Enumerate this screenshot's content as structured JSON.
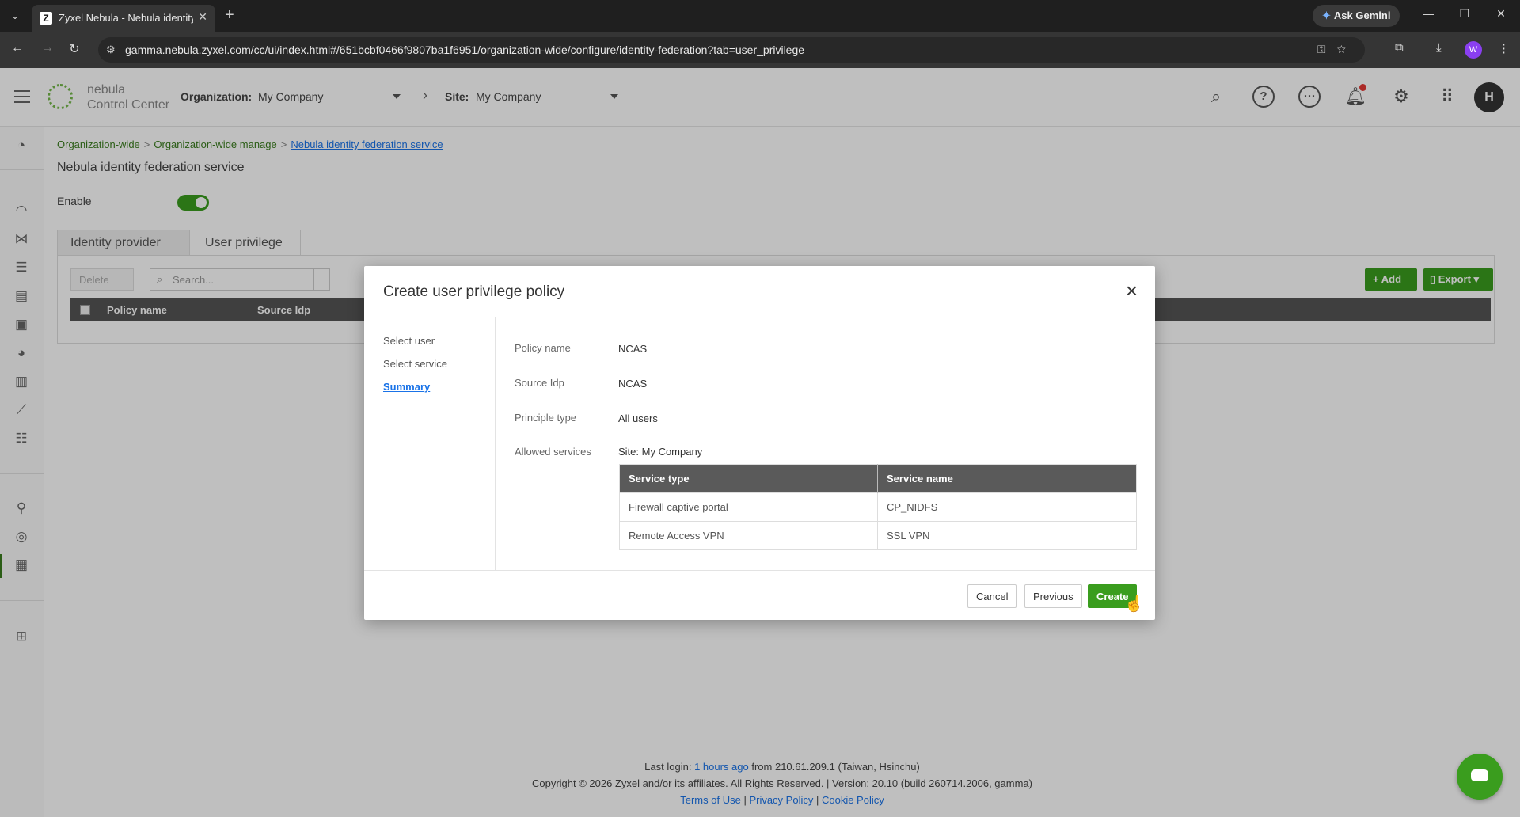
{
  "browser": {
    "tab_title": "Zyxel Nebula - Nebula identity",
    "url": "gamma.nebula.zyxel.com/cc/ui/index.html#/651bcbf0466f9807ba1f6951/organization-wide/configure/identity-federation?tab=user_privilege",
    "gemini_label": "Ask Gemini",
    "profile_initial": "W"
  },
  "header": {
    "logo_line1": "nebula",
    "logo_line2": "Control Center",
    "org_label": "Organization:",
    "org_value": "My Company",
    "site_label": "Site:",
    "site_value": "My Company",
    "avatar_initial": "H"
  },
  "breadcrumb": {
    "items": [
      "Organization-wide",
      "Organization-wide manage",
      "Nebula identity federation service"
    ]
  },
  "page": {
    "title": "Nebula identity federation service",
    "enable_label": "Enable",
    "enable_on": true,
    "tabs": [
      "Identity provider",
      "User privilege"
    ],
    "active_tab": "User privilege",
    "delete_label": "Delete",
    "search_placeholder": "Search...",
    "add_label": "Add",
    "export_label": "Export",
    "columns": [
      "Policy name",
      "Source Idp"
    ]
  },
  "modal": {
    "title": "Create user privilege policy",
    "steps": [
      "Select user",
      "Select service",
      "Summary"
    ],
    "active_step": "Summary",
    "summary": {
      "policy_name_label": "Policy name",
      "policy_name": "NCAS",
      "source_idp_label": "Source Idp",
      "source_idp": "NCAS",
      "principle_type_label": "Principle type",
      "principle_type": "All users",
      "allowed_services_label": "Allowed services",
      "site_line": "Site: My Company"
    },
    "services_table": {
      "headers": [
        "Service type",
        "Service name"
      ],
      "rows": [
        [
          "Firewall captive portal",
          "CP_NIDFS"
        ],
        [
          "Remote Access VPN",
          "SSL VPN"
        ]
      ]
    },
    "cancel_label": "Cancel",
    "previous_label": "Previous",
    "create_label": "Create"
  },
  "footer": {
    "last_login_prefix": "Last login:",
    "last_login_link": "1 hours ago",
    "last_login_suffix": "from 210.61.209.1 (Taiwan, Hsinchu)",
    "copyright": "Copyright © 2026 Zyxel and/or its affiliates. All Rights Reserved. | Version: 20.10 (build 260714.2006, gamma)",
    "links": [
      "Terms of Use",
      "Privacy Policy",
      "Cookie Policy"
    ]
  },
  "colors": {
    "brand_green": "#3a9d1e",
    "link_blue": "#1a73e8",
    "browser_dark": "#1f1f1f"
  }
}
